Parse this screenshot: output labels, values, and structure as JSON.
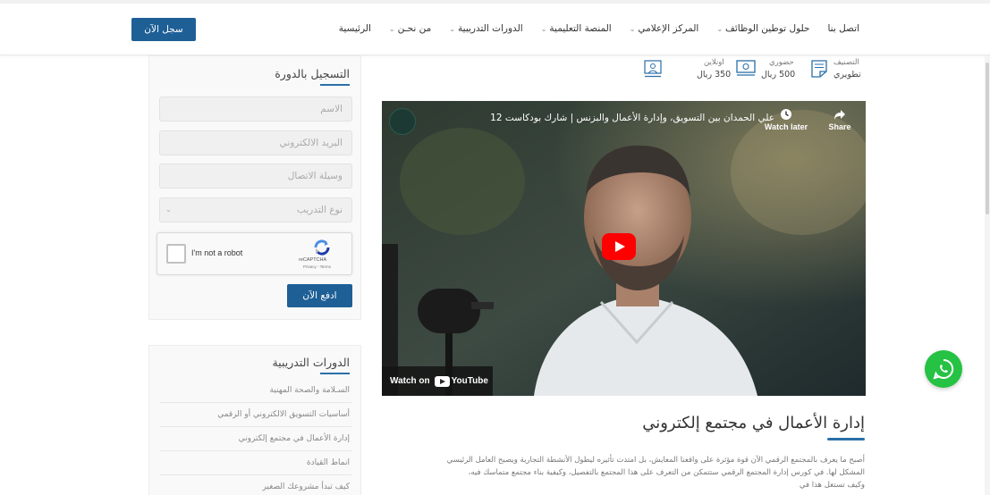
{
  "header": {
    "nav": [
      {
        "label": "الرئيسية",
        "dropdown": false
      },
      {
        "label": "من نحـن",
        "dropdown": true
      },
      {
        "label": "الدورات التدريبية",
        "dropdown": true
      },
      {
        "label": "المنصة التعليمية",
        "dropdown": true
      },
      {
        "label": "المركز الإعلامي",
        "dropdown": true
      },
      {
        "label": "حلول توطين الوظائف",
        "dropdown": true
      },
      {
        "label": "اتصل بنا",
        "dropdown": false
      }
    ],
    "signup_label": "سجل الآن",
    "accent": "#1e5f96"
  },
  "course_meta": {
    "category_label": "التصنيف",
    "category_value": "تطويري",
    "inperson_label": "حضوري",
    "inperson_price": "500 ريال",
    "online_label": "اونلاين",
    "online_price": "350 ريال"
  },
  "registration": {
    "title": "التسجيل بالدورة",
    "name_placeholder": "الاسم",
    "email_placeholder": "البريد الالكتروني",
    "contact_placeholder": "وسيلة الاتصال",
    "type_placeholder": "نوع التدريب",
    "captcha_text": "I'm not a robot",
    "captcha_brand": "reCAPTCHA",
    "captcha_terms": "Privacy - Terms",
    "pay_label": "ادفع الآن"
  },
  "courses": {
    "title": "الدورات التدريبية",
    "items": [
      "السـلامة والصحة المهنية",
      "أساسيات التسويق الالكتروني أو الرقمي",
      "إدارة الأعمال في مجتمع إلكتروني",
      "انماط القيادة",
      "كيف تبدأ مشروعك الصغير"
    ]
  },
  "video": {
    "title": "علي الحمدان بين التسويق، وإدارة الأعمال والبزنس | شارك بودكاست 12",
    "watch_later": "Watch later",
    "share": "Share",
    "watch_on": "Watch on",
    "youtube": "YouTube"
  },
  "article": {
    "title": "إدارة الأعمال في مجتمع إلكتروني",
    "lines": [
      "أصبح ما يعرف بالمجتمع الرقمي الآن قوة مؤثرة على واقعنا المعايش، بل امتدت تأثيره ليطول الأنشطة التجارية ويصبح العامل الرئيسي",
      "المشكل لها. في كورس إدارة المجتمع الرقمي ستتمكن من التعرف على هذا المجتمع بالتفصيل، وكيفية بناء مجتمع متماسك فيه،",
      "وكيف تستغل هذا في"
    ]
  }
}
